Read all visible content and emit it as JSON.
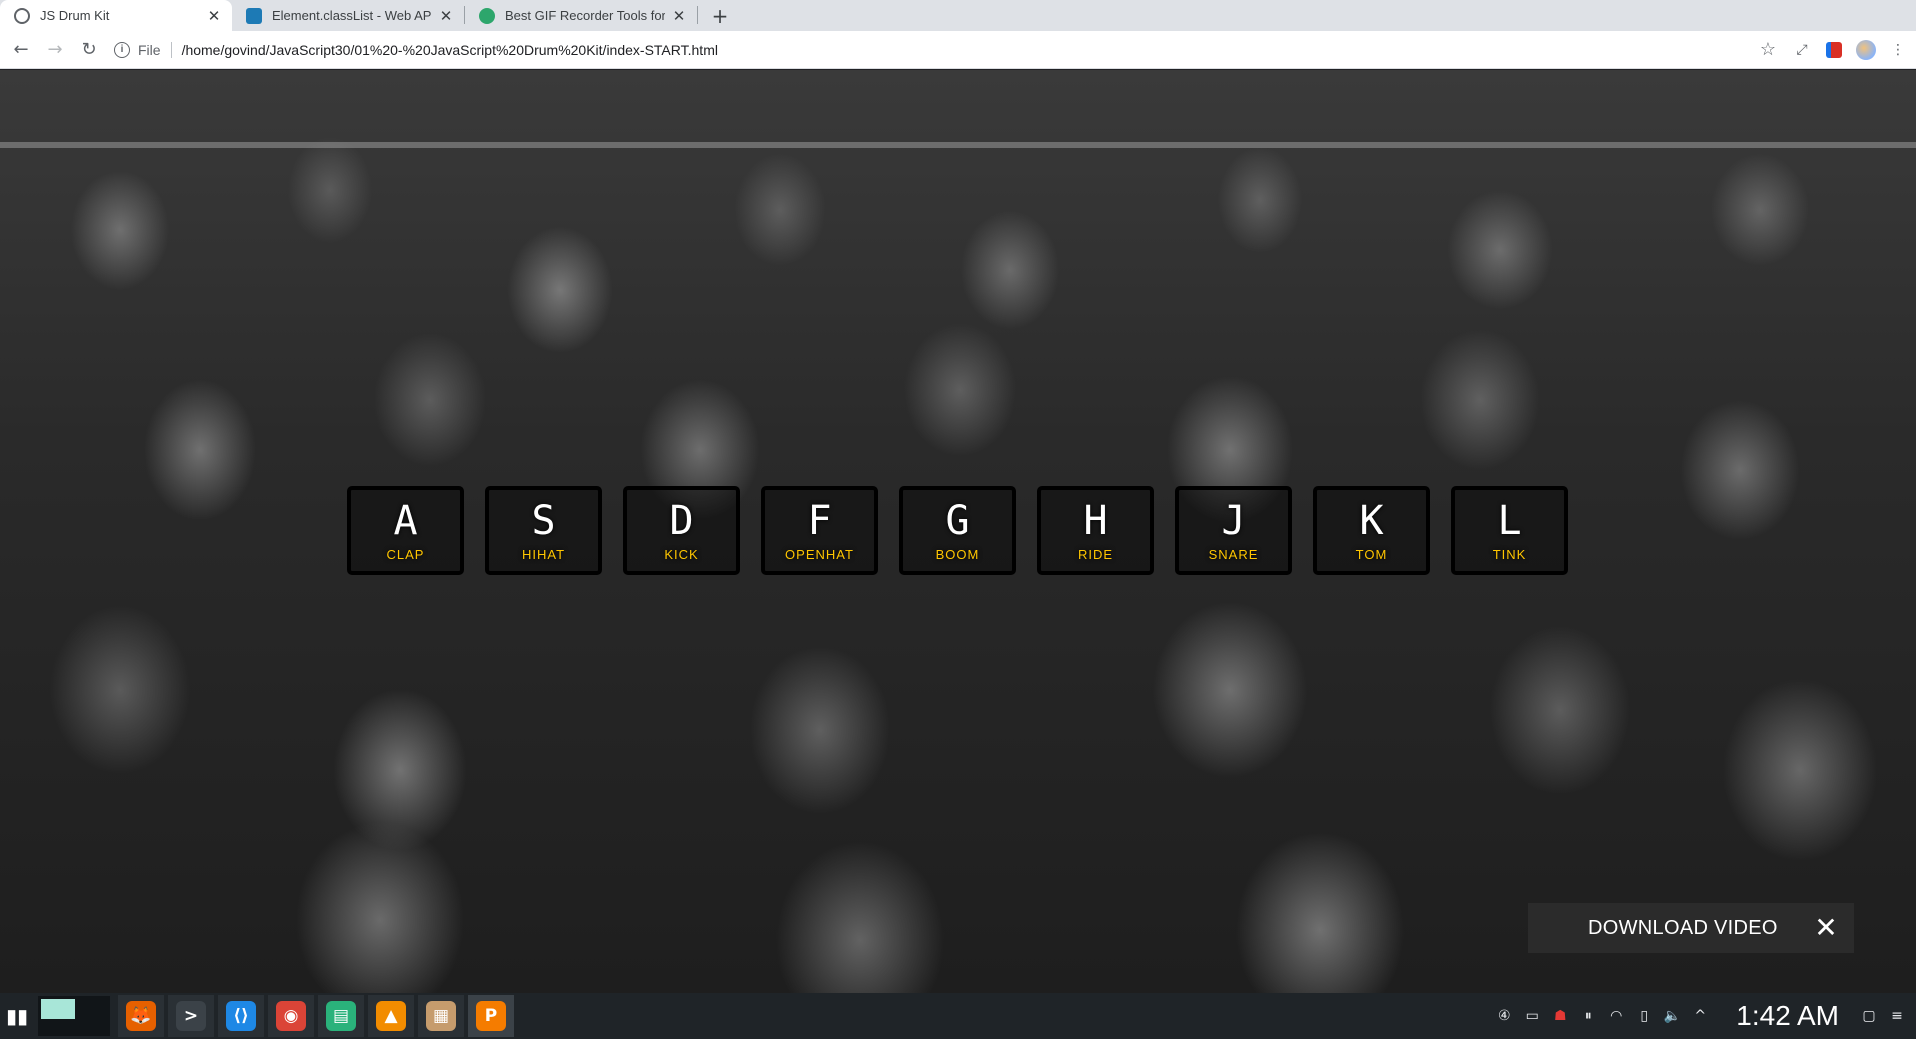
{
  "browser": {
    "tabs": [
      {
        "title": "JS Drum Kit",
        "active": true,
        "favicon_color": "#5f6368"
      },
      {
        "title": "Element.classList - Web APIs",
        "active": false,
        "favicon_color": "#1d7ab5"
      },
      {
        "title": "Best GIF Recorder Tools for Li",
        "active": false,
        "favicon_color": "#2da66c"
      }
    ],
    "tab_close_glyph": "✕",
    "new_tab_glyph": "+",
    "address": {
      "scheme_label": "File",
      "url": "/home/govind/JavaScript30/01%20-%20JavaScript%20Drum%20Kit/index-START.html"
    }
  },
  "drum_kit": {
    "keys": [
      {
        "key": "A",
        "sound": "clap"
      },
      {
        "key": "S",
        "sound": "hihat"
      },
      {
        "key": "D",
        "sound": "kick"
      },
      {
        "key": "F",
        "sound": "openhat"
      },
      {
        "key": "G",
        "sound": "boom"
      },
      {
        "key": "H",
        "sound": "ride"
      },
      {
        "key": "J",
        "sound": "snare"
      },
      {
        "key": "K",
        "sound": "tom"
      },
      {
        "key": "L",
        "sound": "tink"
      }
    ],
    "key_color": "#ffffff",
    "sound_color": "#ffc600"
  },
  "download_bar": {
    "label": "DOWNLOAD VIDEO",
    "close_glyph": "✕"
  },
  "taskbar": {
    "apps": [
      {
        "name": "firefox-app-icon",
        "glyph": "🦊",
        "color": "#e66000"
      },
      {
        "name": "terminal-app-icon",
        "glyph": ">",
        "color": "#3b4248"
      },
      {
        "name": "vscode-app-icon",
        "glyph": "⟨⟩",
        "color": "#1e88e5"
      },
      {
        "name": "chrome-app-icon",
        "glyph": "◉",
        "color": "#db4437"
      },
      {
        "name": "files-app-icon",
        "glyph": "▤",
        "color": "#2ab27b"
      },
      {
        "name": "vlc-app-icon",
        "glyph": "▲",
        "color": "#f28c00"
      },
      {
        "name": "archive-app-icon",
        "glyph": "▦",
        "color": "#c69c6d"
      },
      {
        "name": "app-p-icon",
        "glyph": "P",
        "color": "#f57c00"
      }
    ],
    "clock": "1:42 AM"
  }
}
